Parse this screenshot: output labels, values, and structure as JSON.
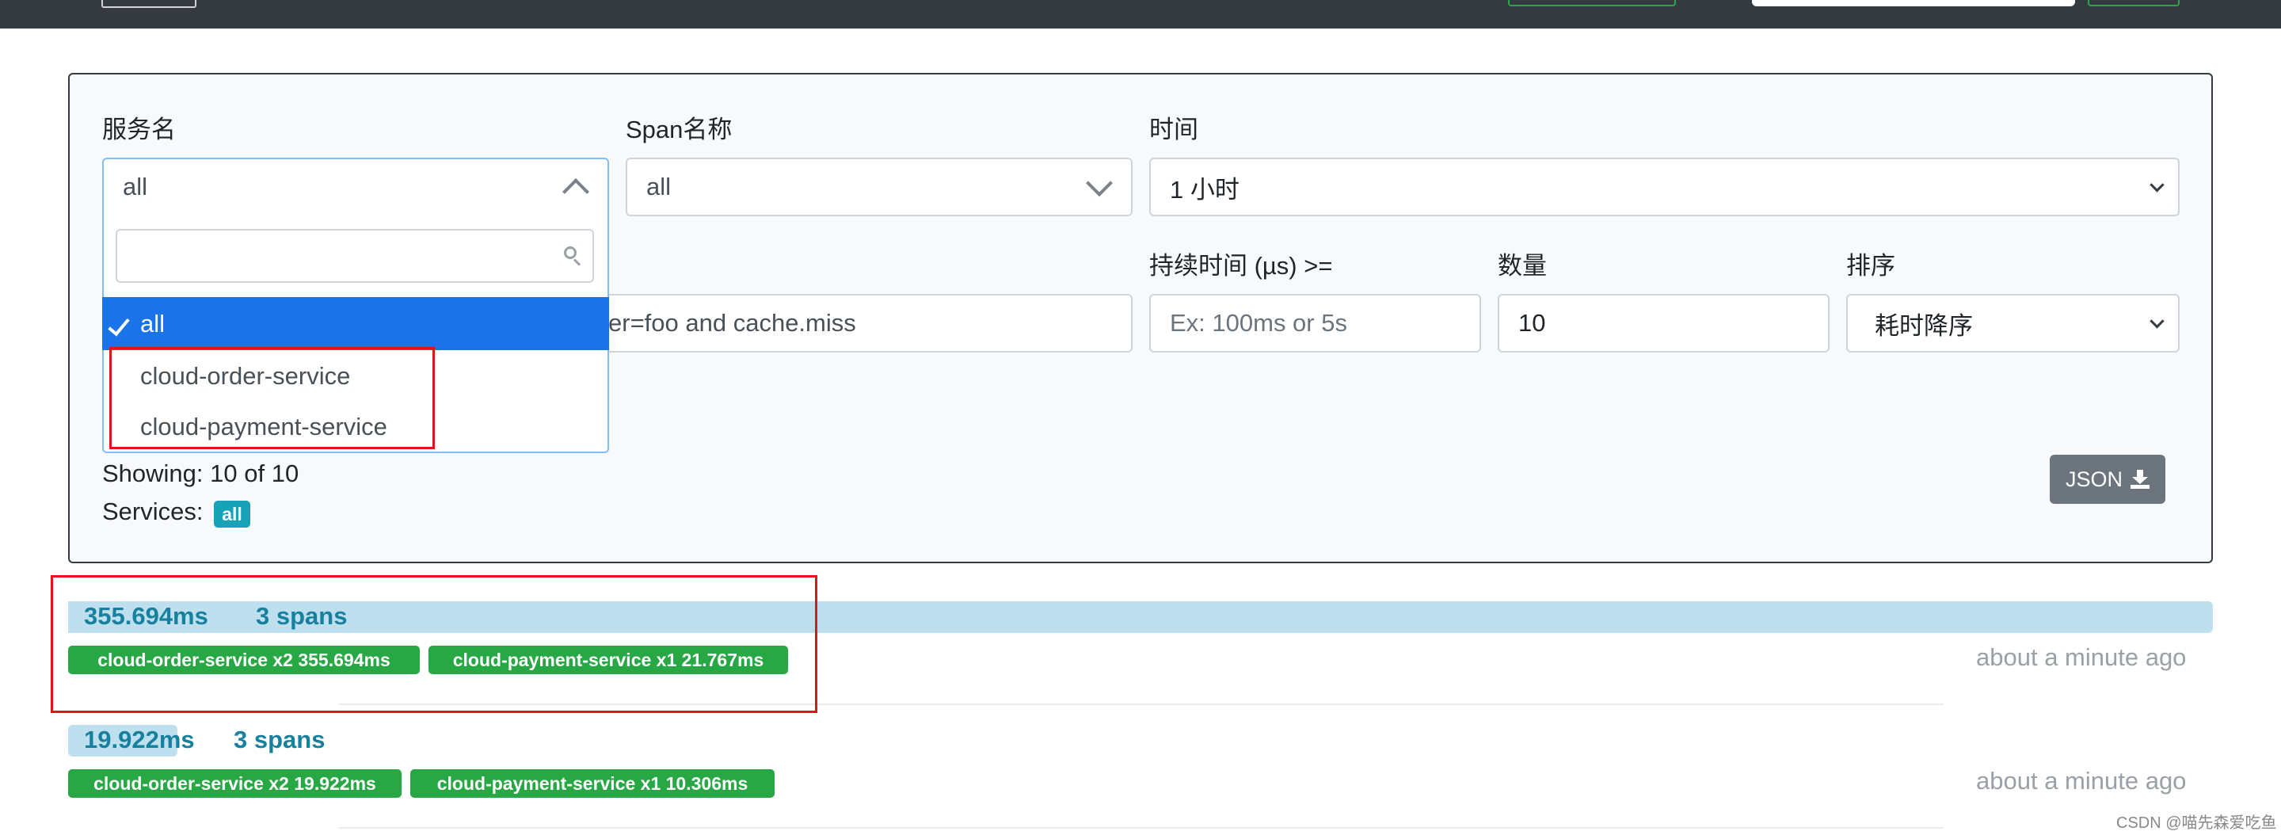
{
  "filters": {
    "service_name_label": "服务名",
    "span_name_label": "Span名称",
    "time_label": "时间",
    "service_value": "all",
    "span_value": "all",
    "time_value": "1 小时",
    "tags_value": "er=foo and cache.miss",
    "duration_label": "持续时间 (µs) >=",
    "duration_placeholder": "Ex: 100ms or 5s",
    "limit_label": "数量",
    "limit_value": "10",
    "sort_label": "排序",
    "sort_value": "耗时降序"
  },
  "service_dropdown": {
    "search_placeholder": "",
    "selected": "all",
    "options": [
      "cloud-order-service",
      "cloud-payment-service"
    ]
  },
  "results": {
    "showing": "Showing: 10 of 10",
    "services_label": "Services:",
    "services_badge": "all",
    "json_button": "JSON"
  },
  "traces": [
    {
      "duration": "355.694ms",
      "spans": "3 spans",
      "bar_fraction": 1.0,
      "services": [
        "cloud-order-service x2 355.694ms",
        "cloud-payment-service x1 21.767ms"
      ],
      "time_ago": "about a minute ago"
    },
    {
      "duration": "19.922ms",
      "spans": "3 spans",
      "bar_fraction": 0.056,
      "services": [
        "cloud-order-service x2 19.922ms",
        "cloud-payment-service x1 10.306ms"
      ],
      "time_ago": "about a minute ago"
    }
  ],
  "watermark": "CSDN @喵先森爱吃鱼",
  "colors": {
    "navbar": "#343a40",
    "select_highlight": "#1a73e8",
    "service_badge": "#28a745",
    "trace_bar": "#bee0ee",
    "trace_text": "#17809f",
    "annotation_box": "#e0141a"
  }
}
